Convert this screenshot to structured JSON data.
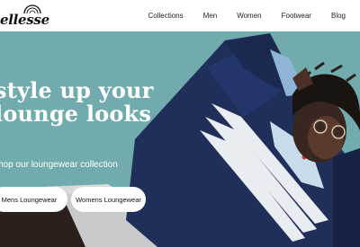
{
  "brand": {
    "name": "ellesse"
  },
  "nav": {
    "items": [
      {
        "label": "Collections"
      },
      {
        "label": "Men"
      },
      {
        "label": "Women"
      },
      {
        "label": "Footwear"
      },
      {
        "label": "Blog"
      }
    ]
  },
  "hero": {
    "headline_line1": "style up your",
    "headline_line2": "lounge looks",
    "subhead": "hop our loungewear collection",
    "buttons": [
      {
        "label": "Mens Loungewear"
      },
      {
        "label": "Womens Loungewear"
      }
    ]
  },
  "colors": {
    "header_bg": "#ffffff",
    "hero_bg": "#6ca7aa",
    "jacket_navy": "#1e2f5a",
    "stripe": "#e9edf2",
    "text_light": "#ffffff"
  }
}
